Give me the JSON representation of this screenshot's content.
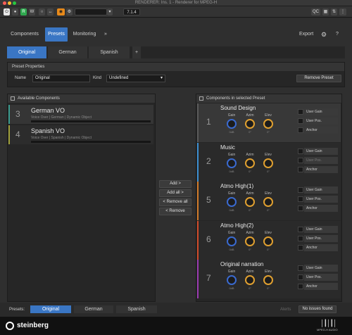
{
  "window": {
    "title": "RENDERER: Ins. 1 - Renderer for MPEG-H"
  },
  "host_toolbar": {
    "read_label": "R",
    "write_label": "W",
    "compare_label": "↔",
    "preset_label": "▾",
    "channel_label": "7.1.4",
    "qc_label": "QC"
  },
  "nav": {
    "tabs": [
      {
        "label": "Components"
      },
      {
        "label": "Presets"
      },
      {
        "label": "Monitoring"
      },
      {
        "label": "»"
      }
    ],
    "export_label": "Export",
    "settings_icon": "gear-icon",
    "help_label": "?"
  },
  "preset_tabs": {
    "tabs": [
      {
        "label": "Original"
      },
      {
        "label": "German"
      },
      {
        "label": "Spanish"
      }
    ],
    "add_label": "+"
  },
  "preset_properties": {
    "title": "Preset Properties",
    "name_label": "Name",
    "name_value": "Original",
    "kind_label": "Kind",
    "kind_value": "Undefined",
    "remove_label": "Remove Preset"
  },
  "available": {
    "title": "Available Components",
    "items": [
      {
        "num": "3",
        "name": "German VO",
        "sub": "Voice Over | German | Dynamic Object",
        "color": "#3a9b8e"
      },
      {
        "num": "4",
        "name": "Spanish VO",
        "sub": "Voice Over | Spanish | Dynamic Object",
        "color": "#a0a03a"
      }
    ]
  },
  "actions": {
    "add": "Add >",
    "add_all": "Add all >",
    "remove_all": "< Remove all",
    "remove": "< Remove"
  },
  "selected": {
    "title": "Components in selected Preset",
    "knob_labels": {
      "gain": "Gain",
      "azim": "Azim",
      "elev": "Elev"
    },
    "knob_values": {
      "gain": "0dB",
      "azim": "0°",
      "elev": "0°"
    },
    "option_labels": {
      "user_gain": "User Gain",
      "user_pos": "User Pos.",
      "anchor": "Anchor"
    },
    "items": [
      {
        "num": "1",
        "name": "Sound Design",
        "color": "#5a5a5a"
      },
      {
        "num": "2",
        "name": "Music",
        "color": "#3c8fd0"
      },
      {
        "num": "5",
        "name": "Atmo High(1)",
        "color": "#d07a2a"
      },
      {
        "num": "6",
        "name": "Atmo High(2)",
        "color": "#d04a2a"
      },
      {
        "num": "7",
        "name": "Original narration",
        "color": "#9a3ab0"
      }
    ]
  },
  "bottom": {
    "presets_label": "Presets:",
    "tabs": [
      {
        "label": "Original"
      },
      {
        "label": "German"
      },
      {
        "label": "Spanish"
      }
    ],
    "status_dim": "Alerts",
    "status": "No issues found"
  },
  "footer": {
    "brand": "steinberg",
    "logo_text": "MPEG-H AUDIO"
  }
}
